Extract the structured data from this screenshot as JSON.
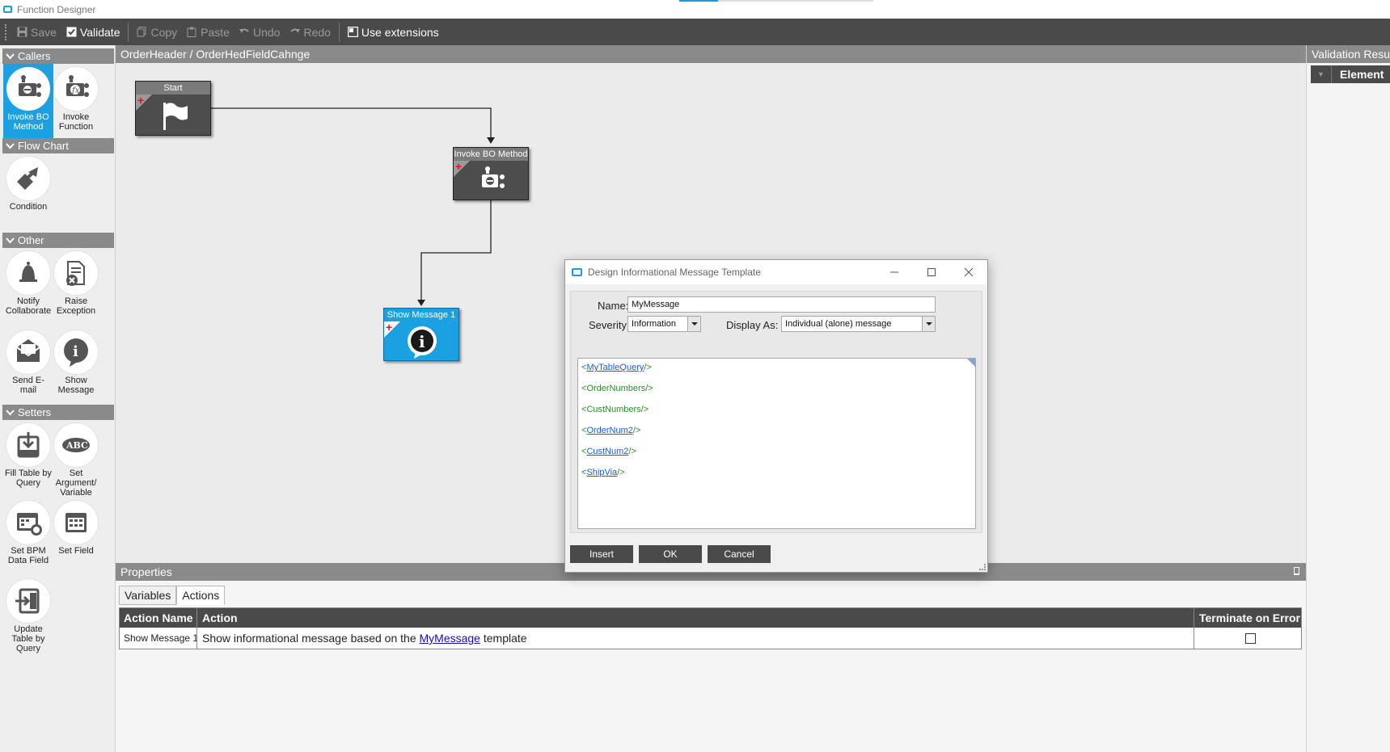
{
  "app": {
    "title": "Function Designer"
  },
  "toolbar": {
    "save": "Save",
    "validate": "Validate",
    "copy": "Copy",
    "paste": "Paste",
    "undo": "Undo",
    "redo": "Redo",
    "use_extensions": "Use extensions"
  },
  "palette": {
    "groups": {
      "callers": "Callers",
      "flowchart": "Flow Chart",
      "other": "Other",
      "setters": "Setters"
    },
    "tools": {
      "invoke_bo": "Invoke BO Method",
      "invoke_fn": "Invoke Function",
      "condition": "Condition",
      "notify": "Notify Collaborate",
      "raise": "Raise Exception",
      "send_email": "Send E-mail",
      "show_message": "Show Message",
      "fill_table": "Fill Table by Query",
      "set_arg": "Set Argument/ Variable",
      "set_bpm": "Set BPM Data Field",
      "set_field": "Set Field",
      "update_table": "Update Table by Query"
    }
  },
  "breadcrumb": "OrderHeader / OrderHedFieldCahnge",
  "nodes": {
    "start": "Start",
    "invoke": "Invoke BO Method",
    "show": "Show Message 1"
  },
  "validation": {
    "title": "Validation Results",
    "column": "Element"
  },
  "properties": {
    "title": "Properties",
    "tabs": [
      "Variables",
      "Actions"
    ],
    "active_tab": "Actions",
    "columns": [
      "Action Name",
      "Action",
      "Terminate on Error"
    ],
    "rows": [
      {
        "name": "Show Message 1",
        "action_prefix": "Show informational message based on the ",
        "action_link": "MyMessage",
        "action_suffix": " template",
        "terminate": false
      }
    ]
  },
  "dialog": {
    "title": "Design Informational Message Template",
    "name_label": "Name:",
    "name_value": "MyMessage",
    "severity_label": "Severity:",
    "severity_value": "Information",
    "display_label": "Display As:",
    "display_value": "Individual (alone) message",
    "template_lines": [
      {
        "name": "MyTableQuery",
        "link": true
      },
      {
        "name": "OrderNumbers",
        "link": false
      },
      {
        "name": "CustNumbers",
        "link": false
      },
      {
        "name": "OrderNum2",
        "link": true
      },
      {
        "name": "CustNum2",
        "link": true
      },
      {
        "name": "ShipVia",
        "link": true
      }
    ],
    "buttons": {
      "insert": "Insert",
      "ok": "OK",
      "cancel": "Cancel"
    }
  },
  "colors": {
    "accent": "#1ba1e2",
    "toolbar": "#4a4a4a",
    "header": "#8a8a8a"
  }
}
